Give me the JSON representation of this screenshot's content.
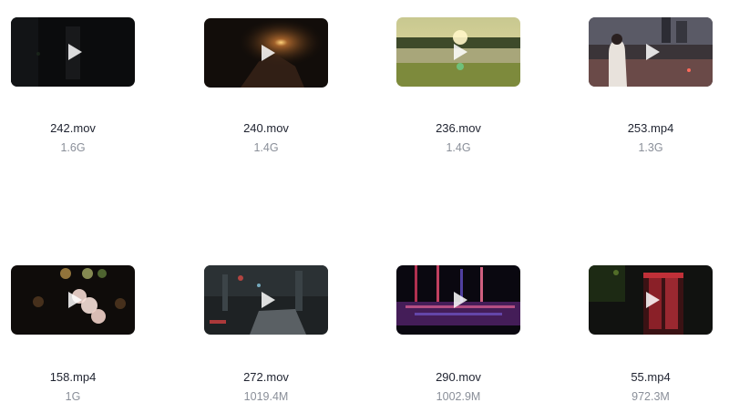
{
  "videos": [
    {
      "name": "242.mov",
      "size": "1.6G",
      "thumbnail": "dark-night-scene"
    },
    {
      "name": "240.mov",
      "size": "1.4G",
      "thumbnail": "hand-holding-light"
    },
    {
      "name": "236.mov",
      "size": "1.4G",
      "thumbnail": "sunset-lake-field"
    },
    {
      "name": "253.mp4",
      "size": "1.3G",
      "thumbnail": "woman-on-city-bridge"
    },
    {
      "name": "158.mp4",
      "size": "1G",
      "thumbnail": "bokeh-lights"
    },
    {
      "name": "272.mov",
      "size": "1019.4M",
      "thumbnail": "rainy-street-cars"
    },
    {
      "name": "290.mov",
      "size": "1002.9M",
      "thumbnail": "neon-reflections"
    },
    {
      "name": "55.mp4",
      "size": "972.3M",
      "thumbnail": "red-phone-booth"
    }
  ],
  "icons": {
    "play": "play-icon"
  },
  "colors": {
    "name_text": "#1f2330",
    "size_text": "#8a8f99",
    "background": "#ffffff"
  }
}
